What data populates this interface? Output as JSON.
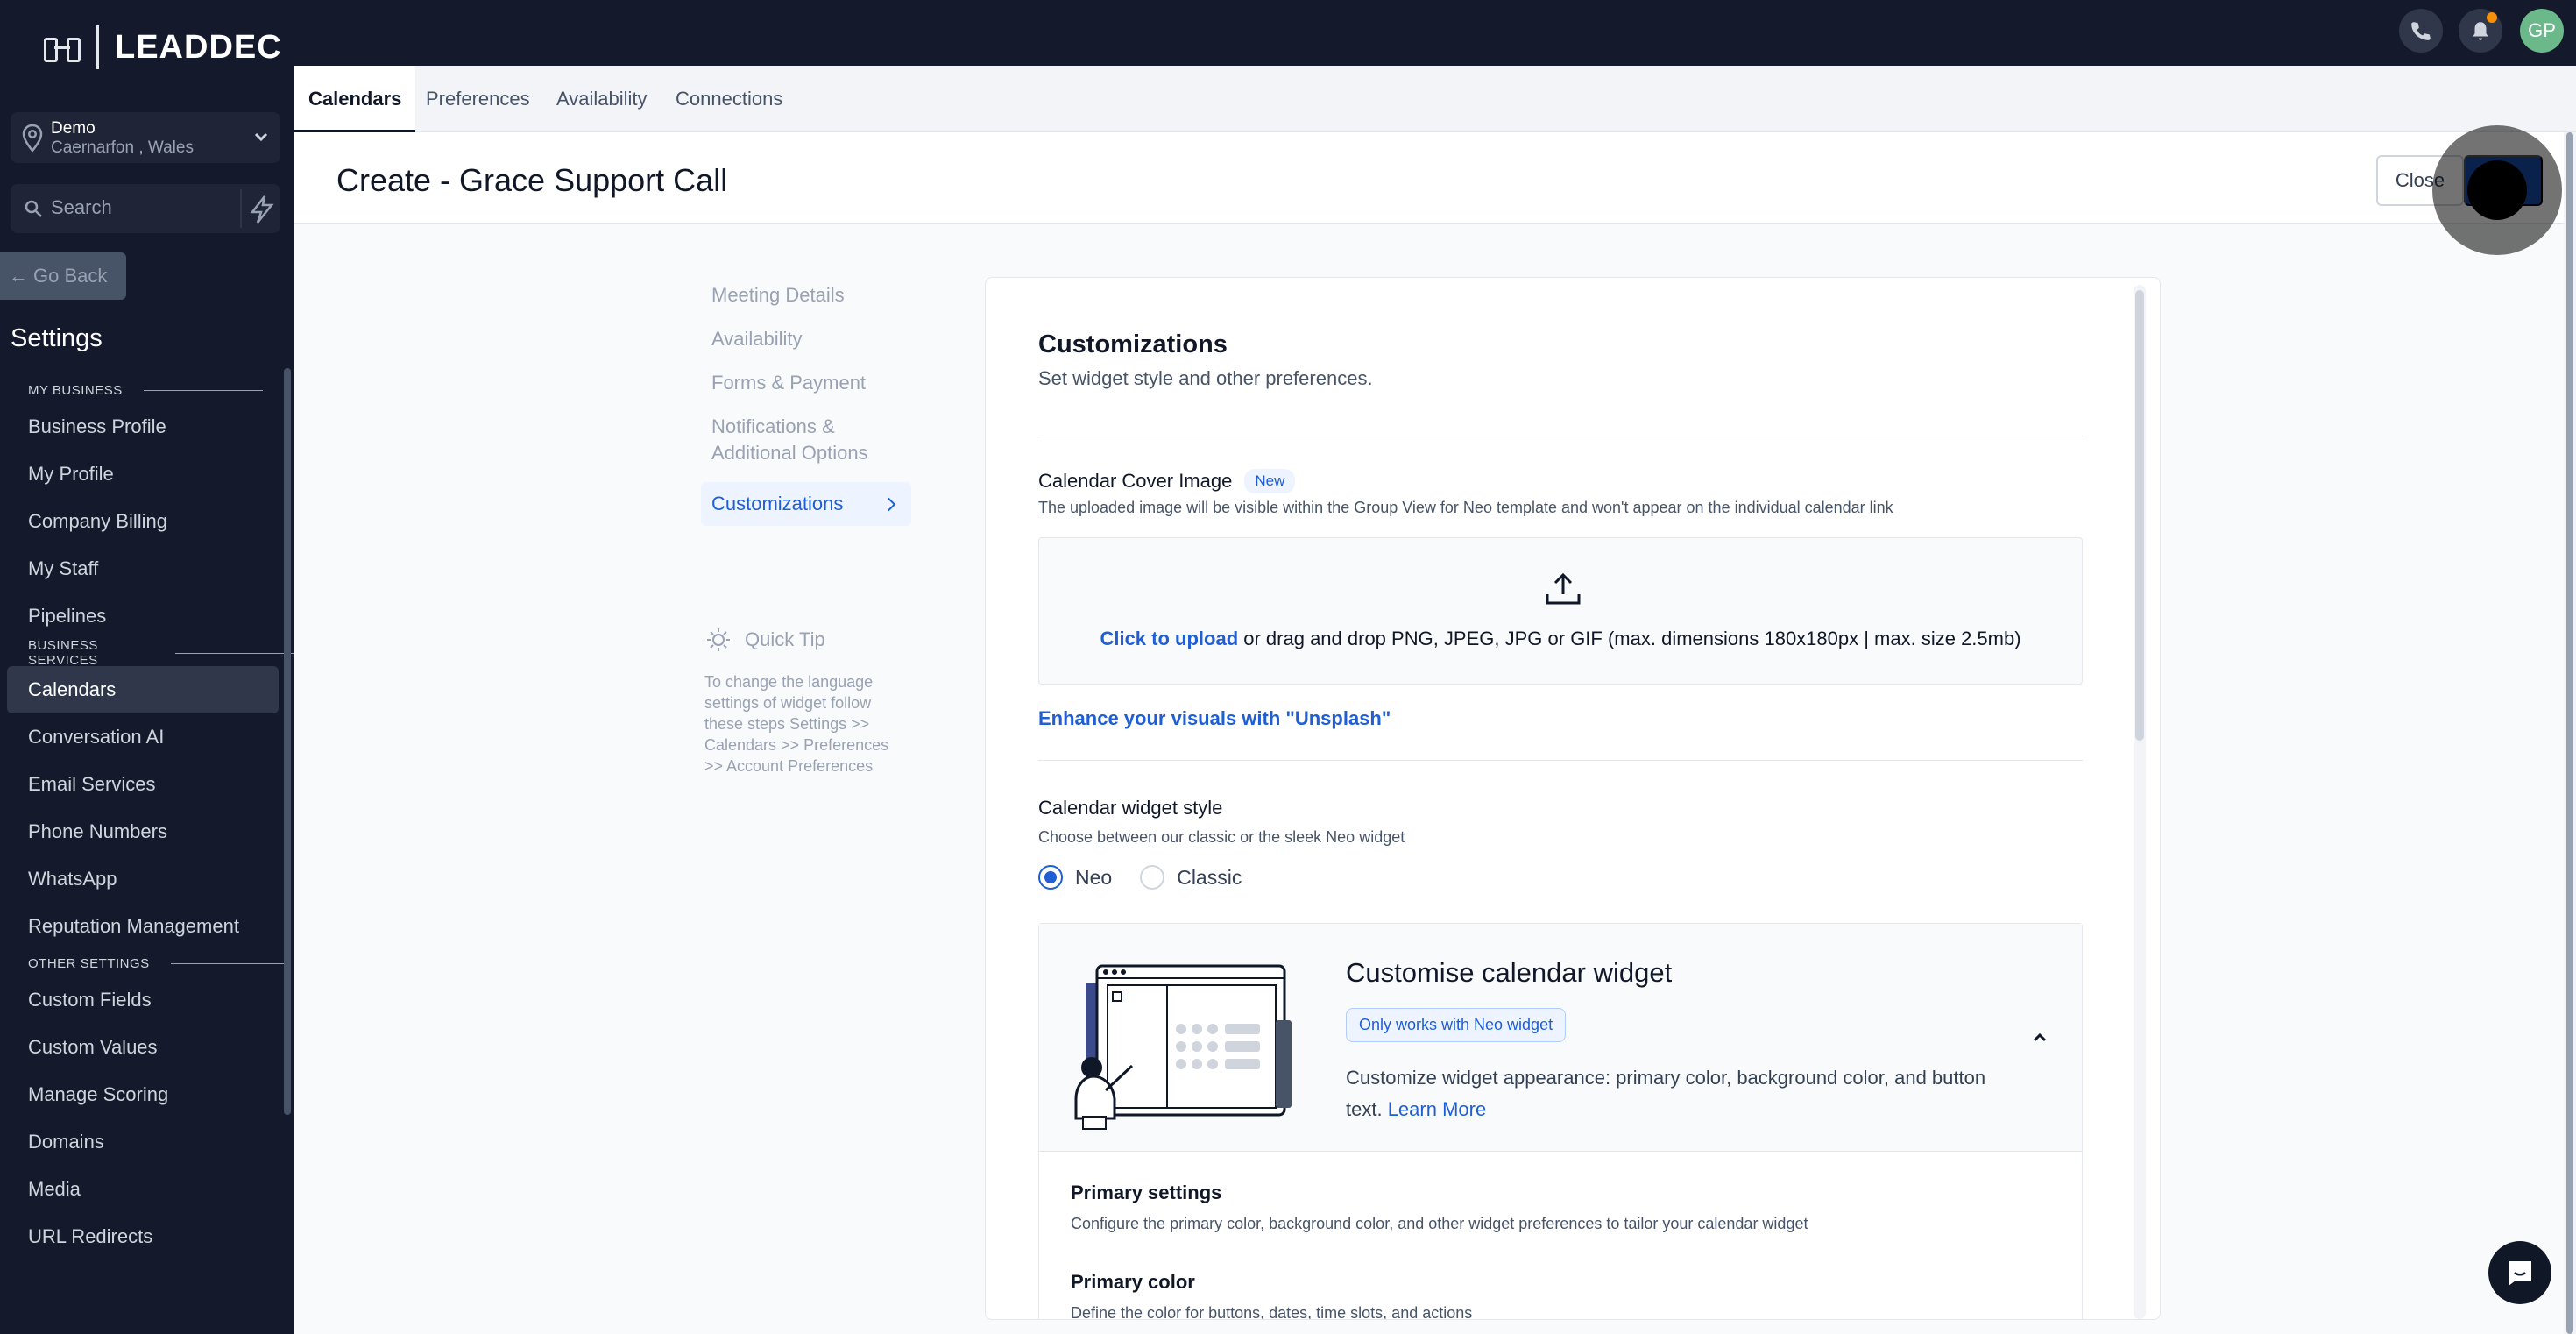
{
  "brand": {
    "name": "LEADDEC"
  },
  "location": {
    "name": "Demo",
    "sub": "Caernarfon , Wales"
  },
  "search": {
    "placeholder": "Search"
  },
  "sidebar": {
    "go_back": "Go Back",
    "title": "Settings",
    "sections": [
      {
        "heading": "MY BUSINESS",
        "items": [
          "Business Profile",
          "My Profile",
          "Company Billing",
          "My Staff",
          "Pipelines"
        ]
      },
      {
        "heading": "BUSINESS SERVICES",
        "items": [
          "Calendars",
          "Conversation AI",
          "Email Services",
          "Phone Numbers",
          "WhatsApp",
          "Reputation Management"
        ]
      },
      {
        "heading": "OTHER SETTINGS",
        "items": [
          "Custom Fields",
          "Custom Values",
          "Manage Scoring",
          "Domains",
          "Media",
          "URL Redirects"
        ]
      }
    ],
    "active_item": "Calendars"
  },
  "header": {
    "avatar_initials": "GP"
  },
  "tabs": [
    "Calendars",
    "Preferences",
    "Availability",
    "Connections"
  ],
  "page": {
    "title": "Create - Grace Support Call",
    "close_label": "Close"
  },
  "steps": [
    "Meeting Details",
    "Availability",
    "Forms & Payment",
    "Notifications & Additional Options",
    "Customizations"
  ],
  "quick_tip": {
    "title": "Quick Tip",
    "body": "To change the language settings of widget follow these steps Settings >> Calendars >> Preferences >> Account Preferences"
  },
  "customizations": {
    "title": "Customizations",
    "subtitle": "Set widget style and other preferences.",
    "cover_label": "Calendar Cover Image",
    "cover_badge": "New",
    "cover_help": "The uploaded image will be visible within the Group View for Neo template and won't appear on the individual calendar link",
    "upload_link": "Click to upload",
    "upload_rest": " or drag and drop PNG, JPEG, JPG or GIF (max. dimensions 180x180px | max. size 2.5mb)",
    "unsplash": "Enhance your visuals with \"Unsplash\"",
    "style_label": "Calendar widget style",
    "style_help": "Choose between our classic or the sleek Neo widget",
    "style_options": [
      "Neo",
      "Classic"
    ],
    "style_selected": "Neo",
    "widget_title": "Customise calendar widget",
    "widget_badge": "Only works with Neo widget",
    "widget_desc": "Customize widget appearance: primary color, background color, and button text. ",
    "widget_learn_more": "Learn More",
    "primary_settings_title": "Primary settings",
    "primary_settings_help": "Configure the primary color, background color, and other widget preferences to tailor your calendar widget",
    "primary_color_title": "Primary color",
    "primary_color_help": "Define the color for buttons, dates, time slots, and actions"
  },
  "colors": {
    "sidebar": "#141a2c",
    "accent": "#1f5ed4",
    "save": "#1849a9",
    "avatar": "#6bb88b"
  }
}
